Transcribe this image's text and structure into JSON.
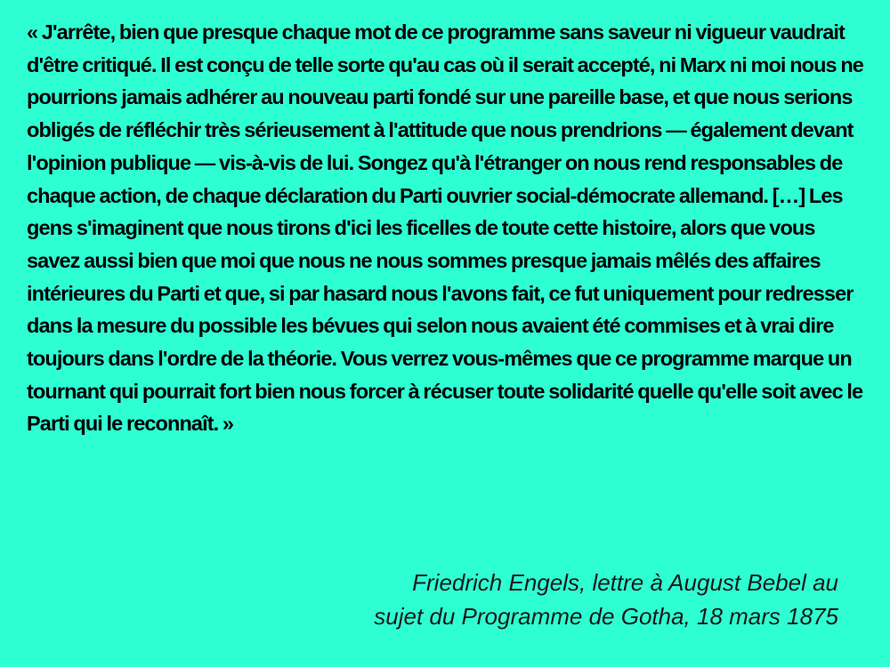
{
  "colors": {
    "background": "#2effd3",
    "quote_text": "#000000",
    "attribution_text": "#1a1a1a"
  },
  "quote": {
    "text": "« J'arrête, bien que presque chaque mot de ce programme sans saveur ni vigueur vaudrait d'être critiqué. Il est conçu de telle sorte qu'au cas où il serait accepté, ni Marx ni moi nous ne pourrions jamais adhérer au nouveau parti fondé sur une pareille base, et que nous serions obligés de réfléchir très sérieusement à l'attitude que nous prendrions — également devant l'opinion publique — vis-à-vis de lui. Songez qu'à l'étranger on nous rend responsables de chaque action, de chaque déclaration du Parti ouvrier social-démocrate allemand. […] Les gens s'imaginent que nous tirons d'ici les ficelles de toute cette histoire, alors que vous savez aussi bien que moi que nous ne nous sommes presque jamais mêlés des affaires intérieures du Parti et que, si par hasard nous l'avons fait, ce fut uniquement pour redresser dans la mesure du possible les bévues qui selon nous avaient été commises et à vrai dire toujours dans l'ordre de la théorie. Vous verrez vous-mêmes que ce programme marque un tournant qui pourrait fort bien nous forcer à récuser toute solidarité quelle qu'elle soit avec le Parti qui le reconnaît. »"
  },
  "attribution": {
    "line1": "Friedrich Engels, lettre à August Bebel au",
    "line2": "sujet du Programme de Gotha, 18 mars 1875"
  }
}
